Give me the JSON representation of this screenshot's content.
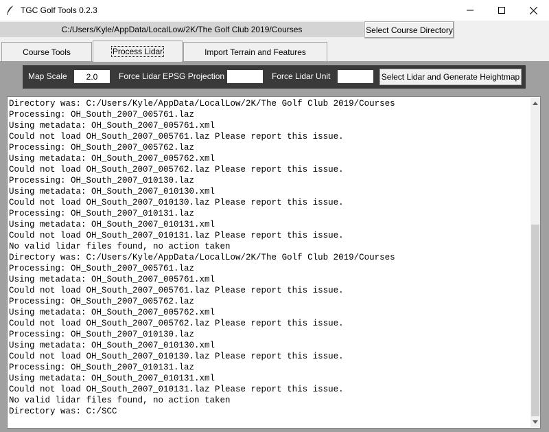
{
  "window": {
    "title": "TGC Golf Tools 0.2.3",
    "icons": {
      "app": "feather-icon",
      "minimize": "minimize-icon",
      "maximize": "maximize-icon",
      "close": "close-icon"
    }
  },
  "pathbar": {
    "path": "C:/Users/Kyle/AppData/LocalLow/2K/The Golf Club 2019/Courses",
    "select_button": "Select Course Directory"
  },
  "tabs": [
    {
      "label": "Course Tools",
      "active": false
    },
    {
      "label": "Process Lidar",
      "active": true
    },
    {
      "label": "Import Terrain and Features",
      "active": false
    }
  ],
  "toolbar": {
    "map_scale_label": "Map Scale",
    "map_scale_value": "2.0",
    "epsg_label": "Force Lidar EPSG Projection",
    "epsg_value": "",
    "unit_label": "Force Lidar Unit",
    "unit_value": "",
    "generate_button": "Select Lidar and Generate Heightmap"
  },
  "log": {
    "lines": [
      "Directory was: C:/Users/Kyle/AppData/LocalLow/2K/The Golf Club 2019/Courses",
      "Processing: OH_South_2007_005761.laz",
      "Using metadata: OH_South_2007_005761.xml",
      "Could not load OH_South_2007_005761.laz Please report this issue.",
      "Processing: OH_South_2007_005762.laz",
      "Using metadata: OH_South_2007_005762.xml",
      "Could not load OH_South_2007_005762.laz Please report this issue.",
      "Processing: OH_South_2007_010130.laz",
      "Using metadata: OH_South_2007_010130.xml",
      "Could not load OH_South_2007_010130.laz Please report this issue.",
      "Processing: OH_South_2007_010131.laz",
      "Using metadata: OH_South_2007_010131.xml",
      "Could not load OH_South_2007_010131.laz Please report this issue.",
      "No valid lidar files found, no action taken",
      "Directory was: C:/Users/Kyle/AppData/LocalLow/2K/The Golf Club 2019/Courses",
      "Processing: OH_South_2007_005761.laz",
      "Using metadata: OH_South_2007_005761.xml",
      "Could not load OH_South_2007_005761.laz Please report this issue.",
      "Processing: OH_South_2007_005762.laz",
      "Using metadata: OH_South_2007_005762.xml",
      "Could not load OH_South_2007_005762.laz Please report this issue.",
      "Processing: OH_South_2007_010130.laz",
      "Using metadata: OH_South_2007_010130.xml",
      "Could not load OH_South_2007_010130.laz Please report this issue.",
      "Processing: OH_South_2007_010131.laz",
      "Using metadata: OH_South_2007_010131.xml",
      "Could not load OH_South_2007_010131.laz Please report this issue.",
      "No valid lidar files found, no action taken",
      "Directory was: C:/SCC"
    ]
  },
  "colors": {
    "toolbar_bg": "#3a3a3a",
    "panel_bg": "#a0a0a0",
    "path_bg": "#d4d4d4"
  }
}
